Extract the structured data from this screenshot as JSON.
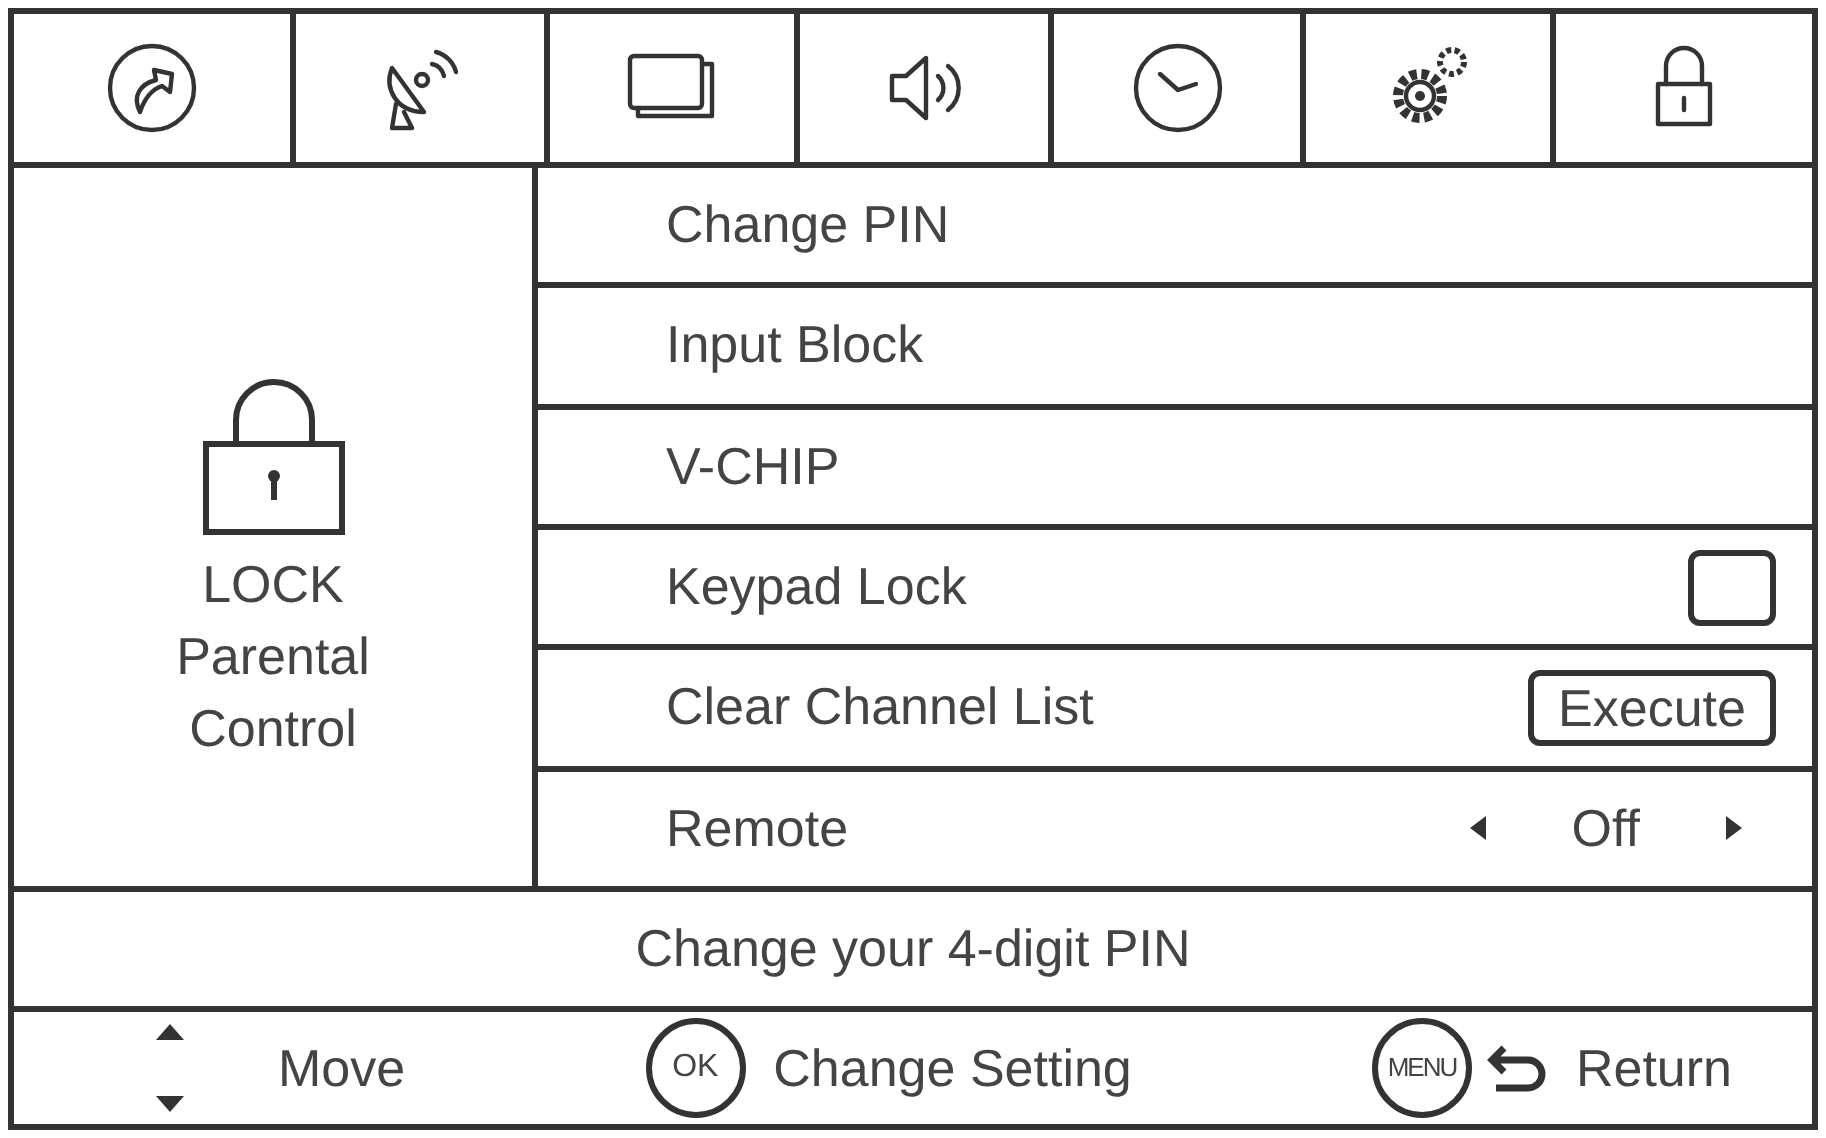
{
  "side_panel": {
    "title": "LOCK",
    "subtitle": "Parental Control"
  },
  "menu_items": [
    {
      "kind": "plain",
      "label": "Change PIN"
    },
    {
      "kind": "plain",
      "label": "Input Block"
    },
    {
      "kind": "plain",
      "label": "V-CHIP"
    },
    {
      "kind": "checkbox",
      "label": "Keypad Lock",
      "checked": false
    },
    {
      "kind": "action",
      "label": "Clear Channel List",
      "action": "Execute"
    },
    {
      "kind": "option",
      "label": "Remote",
      "value": "Off"
    }
  ],
  "help_text": "Change your 4-digit PIN",
  "footer": [
    {
      "kind": "updown",
      "label": "Move"
    },
    {
      "kind": "key",
      "key": "OK",
      "label": "Change Setting"
    },
    {
      "kind": "return",
      "key": "MENU",
      "label": "Return"
    }
  ]
}
